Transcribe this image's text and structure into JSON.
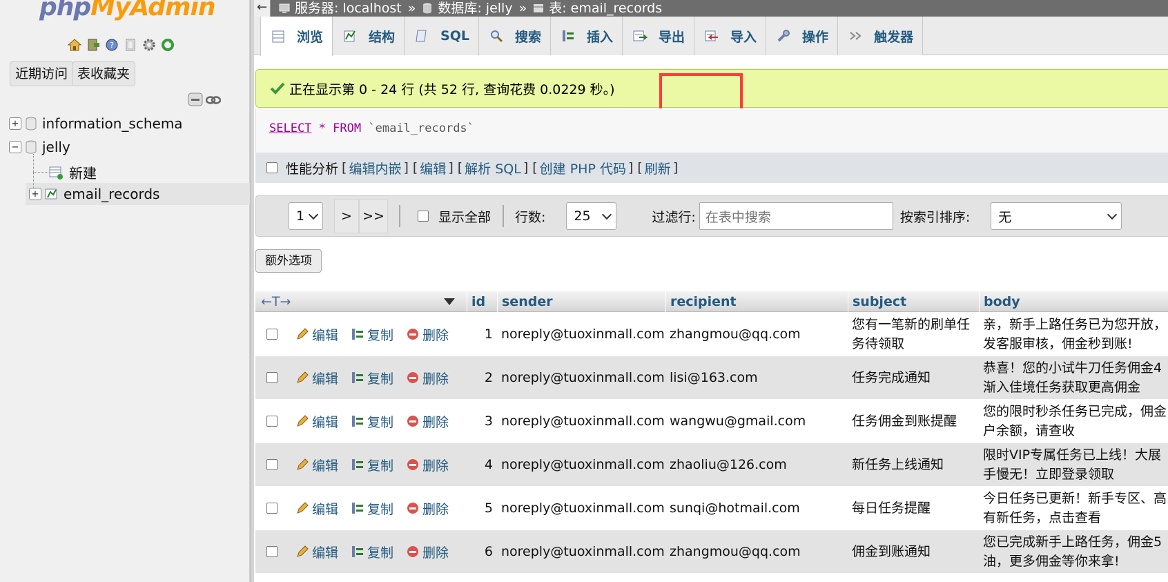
{
  "sidebar": {
    "logo_php": "php",
    "logo_myadmin": "MyAdmin",
    "recent_button": "近期访问",
    "favorites_button": "表收藏夹",
    "tree": [
      {
        "label": "information_schema",
        "expander": "+"
      },
      {
        "label": "jelly",
        "expander": "−"
      },
      {
        "label": "新建"
      },
      {
        "label": "email_records",
        "expander": "+"
      }
    ]
  },
  "breadcrumb": {
    "back": "←",
    "server_label": "服务器: localhost",
    "sep": "»",
    "db_label": "数据库: jelly",
    "table_label": "表: email_records"
  },
  "tabs": [
    {
      "label": "浏览"
    },
    {
      "label": "结构"
    },
    {
      "label": "SQL"
    },
    {
      "label": "搜索"
    },
    {
      "label": "插入"
    },
    {
      "label": "导出"
    },
    {
      "label": "导入"
    },
    {
      "label": "操作"
    },
    {
      "label": "触发器"
    }
  ],
  "message": {
    "text": "正在显示第 0 - 24 行 (共 52 行, 查询花费 0.0229 秒。)"
  },
  "sql": {
    "select": "SELECT",
    "star": "*",
    "from": "FROM",
    "table": "`email_records`"
  },
  "tools": {
    "profiling": "性能分析",
    "links": [
      "编辑内嵌",
      "编辑",
      "解析 SQL",
      "创建 PHP 代码",
      "刷新"
    ],
    "open_bracket": "[",
    "close_bracket": "]"
  },
  "navigation": {
    "page_value": "1",
    "next": ">",
    "last": ">>",
    "show_all": "显示全部",
    "rows_label": "行数:",
    "rows_value": "25",
    "filter_label": "过滤行:",
    "filter_placeholder": "在表中搜索",
    "sort_label": "按索引排序:",
    "sort_value": "无"
  },
  "extra_options": "额外选项",
  "table": {
    "arrows": "←T→",
    "columns": [
      "id",
      "sender",
      "recipient",
      "subject",
      "body"
    ],
    "actions": {
      "edit": "编辑",
      "copy": "复制",
      "delete": "删除"
    },
    "rows": [
      {
        "id": "1",
        "sender": "noreply@tuoxinmall.com",
        "recipient": "zhangmou@qq.com",
        "subject": "您有一笔新的刷单任务待领取",
        "body": "亲，新手上路任务已为您开放，发客服审核，佣金秒到账!"
      },
      {
        "id": "2",
        "sender": "noreply@tuoxinmall.com",
        "recipient": "lisi@163.com",
        "subject": "任务完成通知",
        "body": "恭喜！您的小试牛刀任务佣金4渐入佳境任务获取更高佣金"
      },
      {
        "id": "3",
        "sender": "noreply@tuoxinmall.com",
        "recipient": "wangwu@gmail.com",
        "subject": "任务佣金到账提醒",
        "body": "您的限时秒杀任务已完成，佣金户余额，请查收"
      },
      {
        "id": "4",
        "sender": "noreply@tuoxinmall.com",
        "recipient": "zhaoliu@126.com",
        "subject": "新任务上线通知",
        "body": "限时VIP专属任务已上线！大展手慢无！立即登录领取"
      },
      {
        "id": "5",
        "sender": "noreply@tuoxinmall.com",
        "recipient": "sunqi@hotmail.com",
        "subject": "每日任务提醒",
        "body": "今日任务已更新！新手专区、高有新任务，点击查看"
      },
      {
        "id": "6",
        "sender": "noreply@tuoxinmall.com",
        "recipient": "zhangmou@qq.com",
        "subject": "佣金到账通知",
        "body": "您已完成新手上路任务，佣金5油，更多佣金等你来拿!"
      }
    ]
  },
  "colors": {
    "link": "#235a81",
    "success_bg": "#ebf8a4",
    "highlight": "#ff3b3b"
  }
}
